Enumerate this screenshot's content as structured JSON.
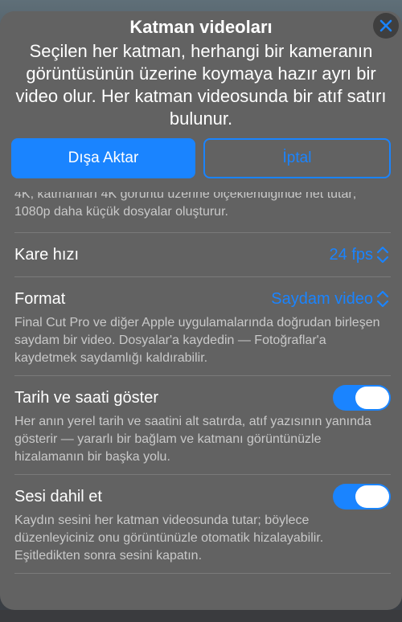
{
  "sheet": {
    "title": "Katman videoları",
    "subtitle": "Seçilen her katman, herhangi bir kameranın görüntüsünün üzerine koymaya hazır ayrı bir video olur. Her katman videosunda bir atıf satırı bulunur.",
    "close_icon": "close-icon",
    "export_label": "Dışa Aktar",
    "cancel_label": "İptal"
  },
  "resolution": {
    "desc_clipped": "4K, katmanları 4K görüntü üzerine ölçeklendiğinde net tutar; 1080p daha küçük dosyalar oluşturur."
  },
  "frame_rate": {
    "label": "Kare hızı",
    "value": "24 fps"
  },
  "format": {
    "label": "Format",
    "value": "Saydam video",
    "desc": "Final Cut Pro ve diğer Apple uygulamalarında doğrudan birleşen saydam bir video. Dosyalar'a kaydedin — Fotoğraflar'a kaydetmek saydamlığı kaldırabilir."
  },
  "show_datetime": {
    "label": "Tarih ve saati göster",
    "enabled": true,
    "desc": "Her anın yerel tarih ve saatini alt satırda, atıf yazısının yanında gösterir — yararlı bir bağlam ve katmanı görüntünüzle hizalamanın bir başka yolu."
  },
  "include_audio": {
    "label": "Sesi dahil et",
    "enabled": true,
    "desc": "Kaydın sesini her katman videosunda tutar; böylece düzenleyiciniz onu görüntünüzle otomatik hizalayabilir. Eşitledikten sonra sesini kapatın."
  },
  "colors": {
    "accent": "#1a84ff",
    "sheet_bg": "#626262",
    "secondary_text": "#c9c9c9"
  }
}
